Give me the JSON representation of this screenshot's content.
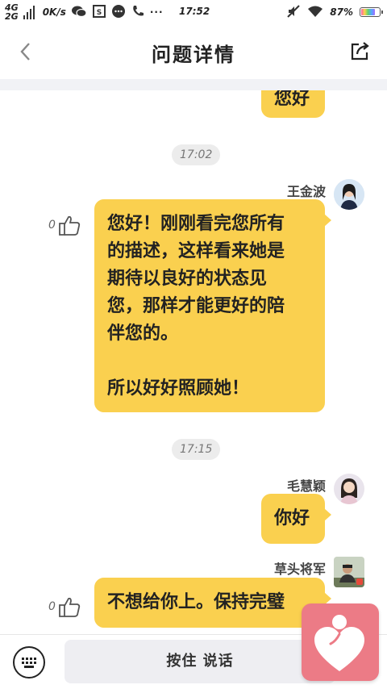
{
  "status_bar": {
    "network_top": "4G",
    "network_bottom": "2G",
    "speed": "0K/s",
    "time": "17:52",
    "battery": "87%",
    "battery_level": 0.87
  },
  "header": {
    "title": "问题详情"
  },
  "messages": {
    "partial_top": {
      "text": "您好"
    },
    "time1": "17:02",
    "msg1": {
      "sender": "王金波",
      "likes": "0",
      "lines": [
        "您好！刚刚看完您所有",
        "的描述，这样看来她是",
        "期待以良好的状态见",
        "您，那样才能更好的陪",
        "伴您的。",
        "",
        "所以好好照顾她！"
      ]
    },
    "time2": "17:15",
    "msg2": {
      "sender": "毛慧颖",
      "text": "你好"
    },
    "msg3": {
      "sender": "草头将军",
      "likes": "0",
      "text": "不想给你上。保持完璧"
    }
  },
  "bottom": {
    "hold_to_talk": "按住 说话"
  },
  "colors": {
    "bubble": "#fad04f",
    "float_button": "#ec7b86"
  }
}
